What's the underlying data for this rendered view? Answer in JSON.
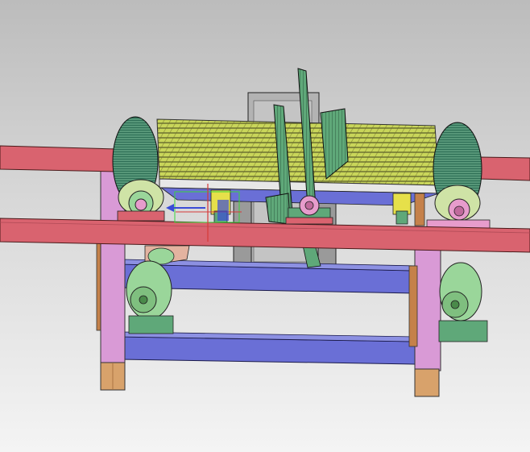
{
  "viewport": {
    "background_top": "#bcbcbc",
    "background_bottom": "#f4f4f4"
  },
  "model": {
    "description_colors": {
      "rail": "#d9636f",
      "leg": "#d99ad6",
      "foot": "#d8a26b",
      "crossbeam": "#6a6fd6",
      "wheel": "#9ad69a",
      "mesh": "#c9d65a",
      "blade": "#5fa879",
      "bearing_pink": "#e79ccc",
      "column": "#b3b3b3",
      "axis_blue": "#3a4bd6",
      "axis_red": "#d63a3a",
      "axis_green": "#3ad63a"
    }
  }
}
